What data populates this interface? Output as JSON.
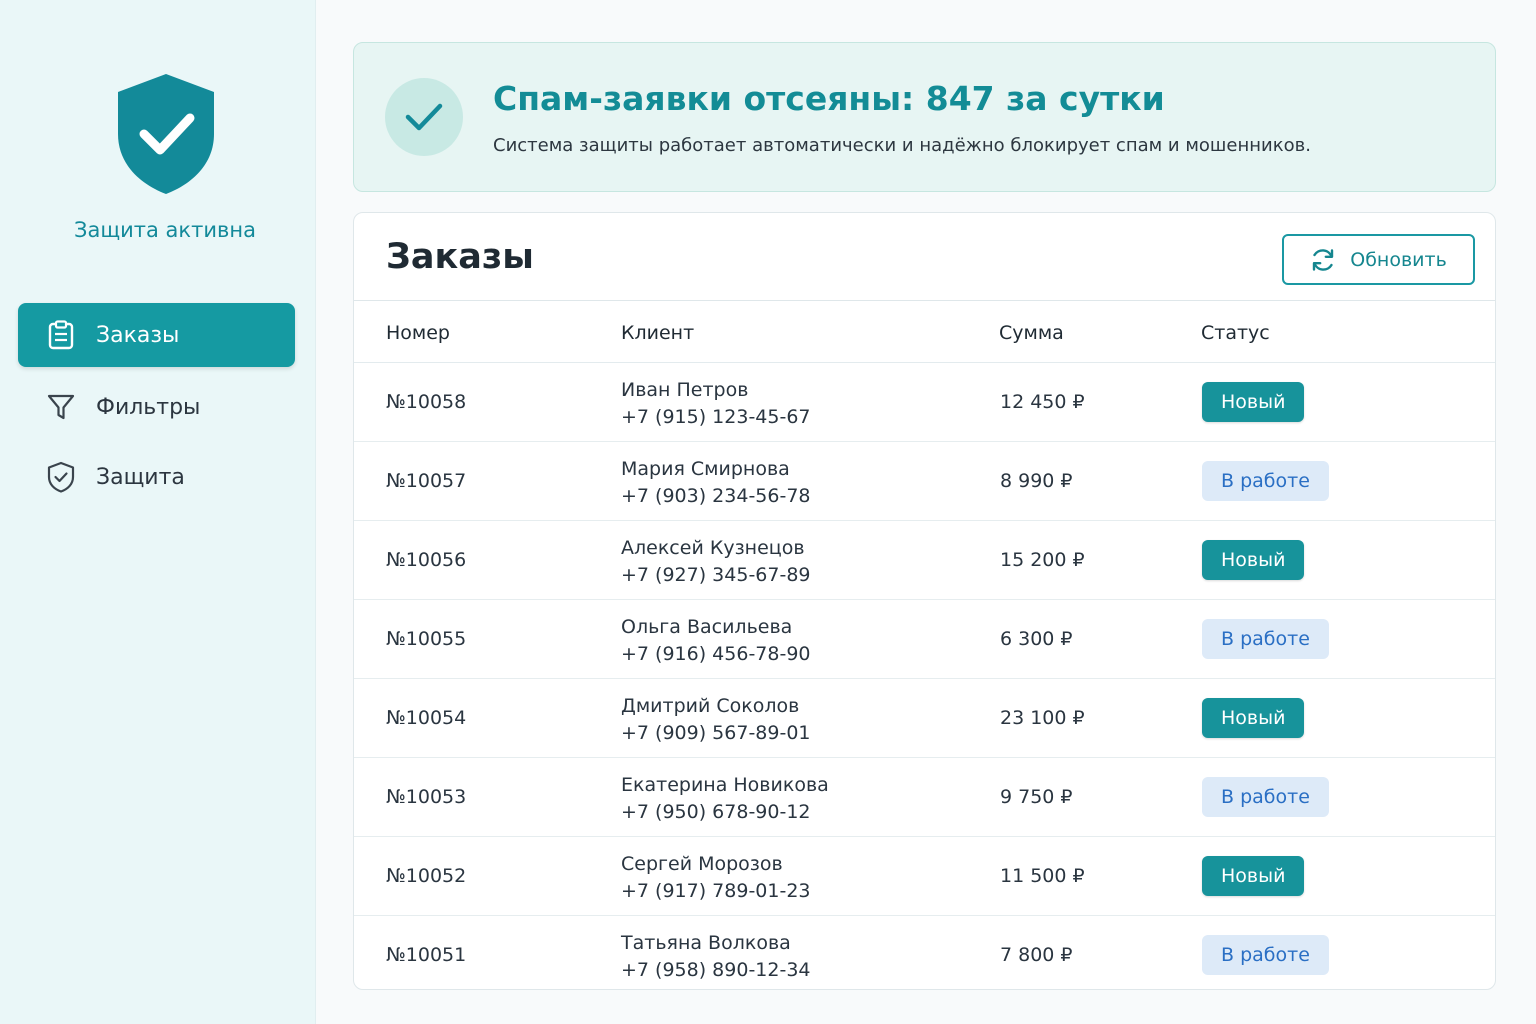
{
  "sidebar": {
    "protection_status": "Защита активна",
    "items": [
      {
        "label": "Заказы",
        "icon": "clipboard-icon",
        "active": true
      },
      {
        "label": "Фильтры",
        "icon": "filter-icon",
        "active": false
      },
      {
        "label": "Защита",
        "icon": "shield-icon",
        "active": false
      }
    ]
  },
  "banner": {
    "title": "Спам-заявки отсеяны: 847 за сутки",
    "subtitle": "Система защиты работает автоматически и надёжно блокирует спам и мошенников."
  },
  "orders": {
    "title": "Заказы",
    "refresh_label": "Обновить",
    "columns": {
      "number": "Номер",
      "client": "Клиент",
      "sum": "Сумма",
      "status": "Статус"
    },
    "rows": [
      {
        "number": "№10058",
        "name": "Иван Петров",
        "phone": "+7 (915) 123-45-67",
        "sum": "12 450 ₽",
        "status": "Новый",
        "status_type": "new"
      },
      {
        "number": "№10057",
        "name": "Мария Смирнова",
        "phone": "+7 (903) 234-56-78",
        "sum": "8 990 ₽",
        "status": "В работе",
        "status_type": "work"
      },
      {
        "number": "№10056",
        "name": "Алексей Кузнецов",
        "phone": "+7 (927) 345-67-89",
        "sum": "15 200 ₽",
        "status": "Новый",
        "status_type": "new"
      },
      {
        "number": "№10055",
        "name": "Ольга Васильева",
        "phone": "+7 (916) 456-78-90",
        "sum": "6 300 ₽",
        "status": "В работе",
        "status_type": "work"
      },
      {
        "number": "№10054",
        "name": "Дмитрий Соколов",
        "phone": "+7 (909) 567-89-01",
        "sum": "23 100 ₽",
        "status": "Новый",
        "status_type": "new"
      },
      {
        "number": "№10053",
        "name": "Екатерина Новикова",
        "phone": "+7 (950) 678-90-12",
        "sum": "9 750 ₽",
        "status": "В работе",
        "status_type": "work"
      },
      {
        "number": "№10052",
        "name": "Сергей Морозов",
        "phone": "+7 (917) 789-01-23",
        "sum": "11 500 ₽",
        "status": "Новый",
        "status_type": "new"
      },
      {
        "number": "№10051",
        "name": "Татьяна Волкова",
        "phone": "+7 (958) 890-12-34",
        "sum": "7 800 ₽",
        "status": "В работе",
        "status_type": "work"
      }
    ]
  },
  "colors": {
    "accent": "#159aa2",
    "status_new": "#17939b",
    "status_work_bg": "#ddeaf8",
    "status_work_text": "#2a6fc4"
  }
}
